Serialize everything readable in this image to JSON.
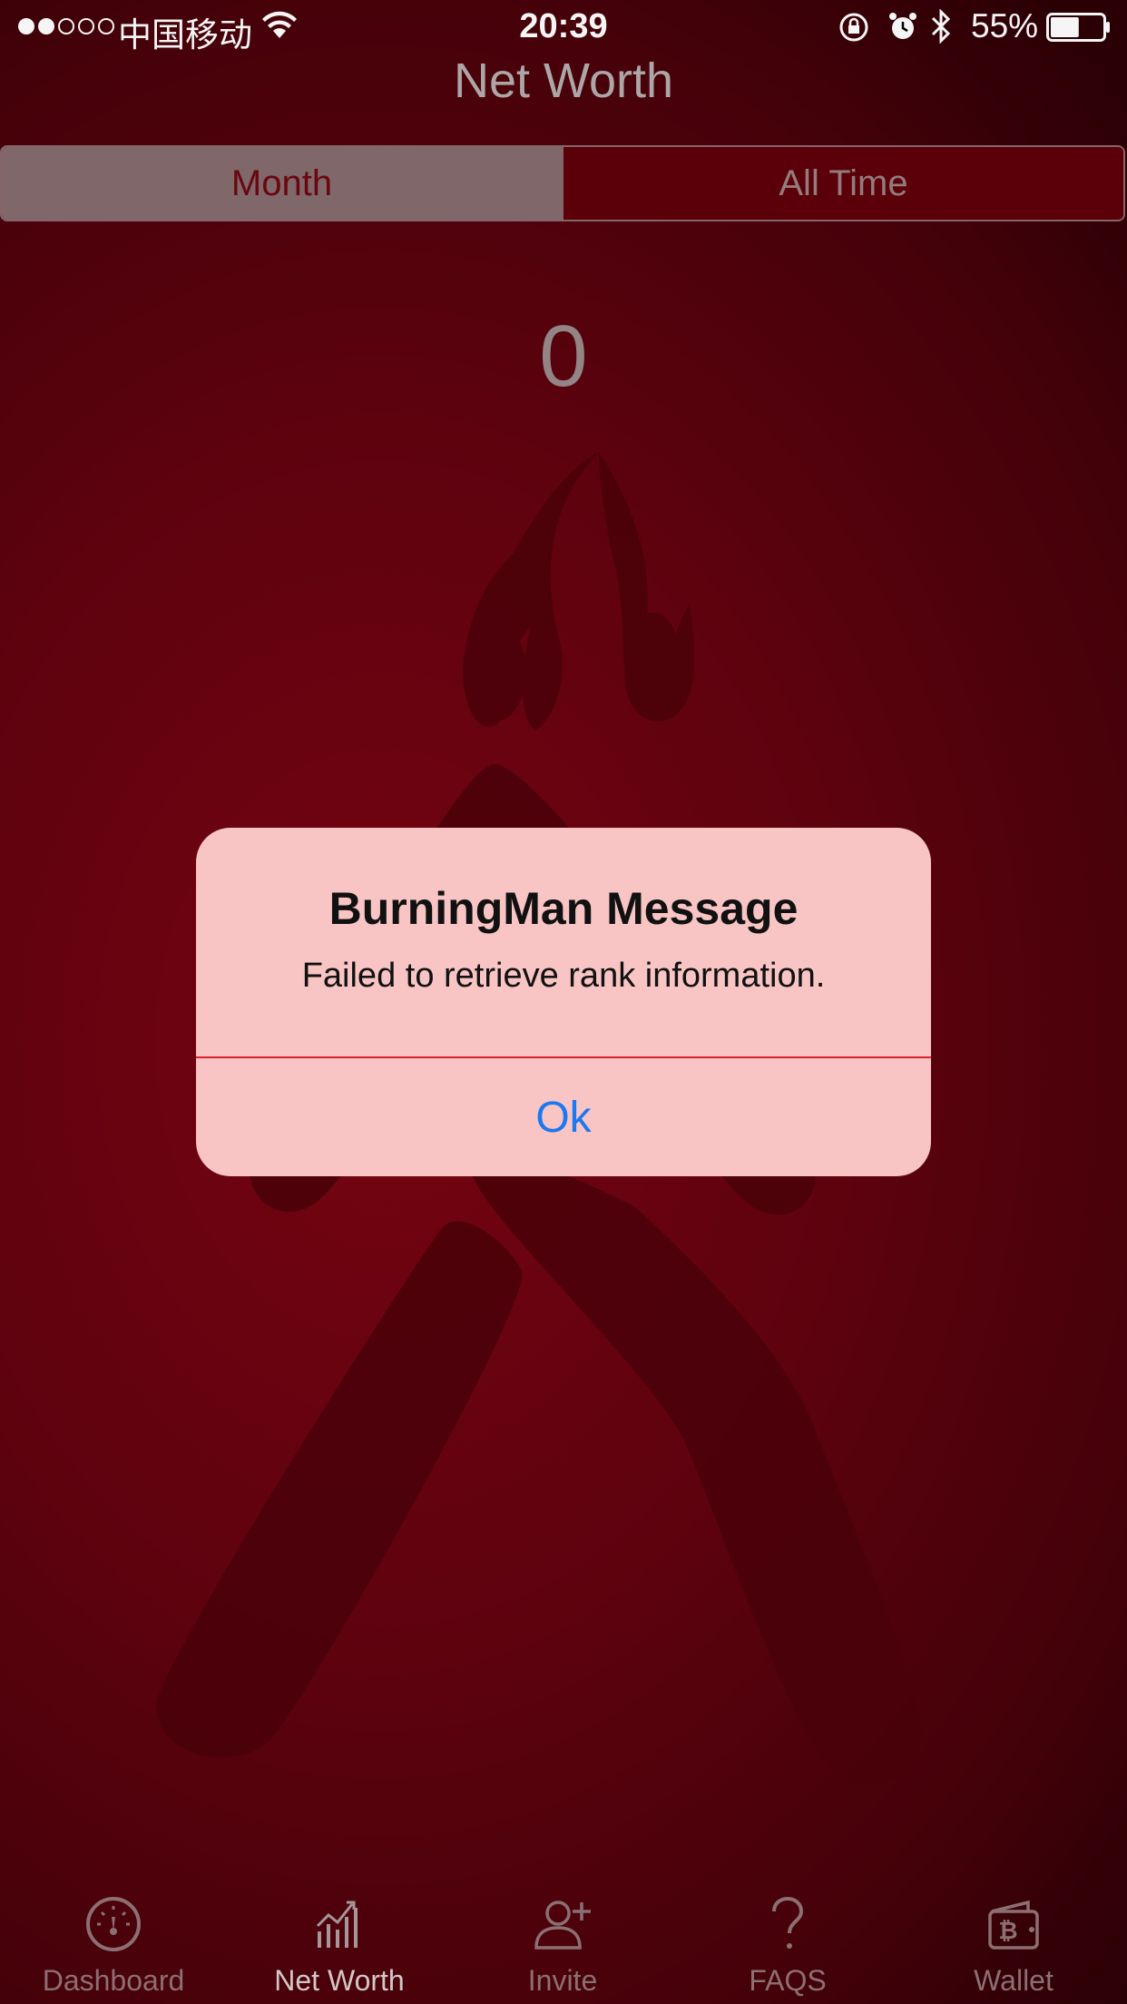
{
  "status_bar": {
    "carrier": "中国移动",
    "time": "20:39",
    "battery": "55%",
    "signal_bars_filled": 2,
    "signal_bars_total": 5,
    "battery_level": 0.55
  },
  "header": {
    "title": "Net Worth"
  },
  "segmented": {
    "items": [
      {
        "label": "Month",
        "selected": true
      },
      {
        "label": "All Time",
        "selected": false
      }
    ]
  },
  "main": {
    "value": "0"
  },
  "alert": {
    "title": "BurningMan Message",
    "message": "Failed to retrieve rank information.",
    "button": "Ok"
  },
  "tabs": [
    {
      "label": "Dashboard",
      "icon": "gauge-icon",
      "active": false
    },
    {
      "label": "Net Worth",
      "icon": "chart-icon",
      "active": true
    },
    {
      "label": "Invite",
      "icon": "add-user-icon",
      "active": false
    },
    {
      "label": "FAQS",
      "icon": "question-icon",
      "active": false
    },
    {
      "label": "Wallet",
      "icon": "bitcoin-wallet-icon",
      "active": false
    }
  ],
  "colors": {
    "background": "#6a0510",
    "alert_bg": "#f8c4c4",
    "alert_button": "#1a78f0",
    "divider": "#d9202c"
  }
}
